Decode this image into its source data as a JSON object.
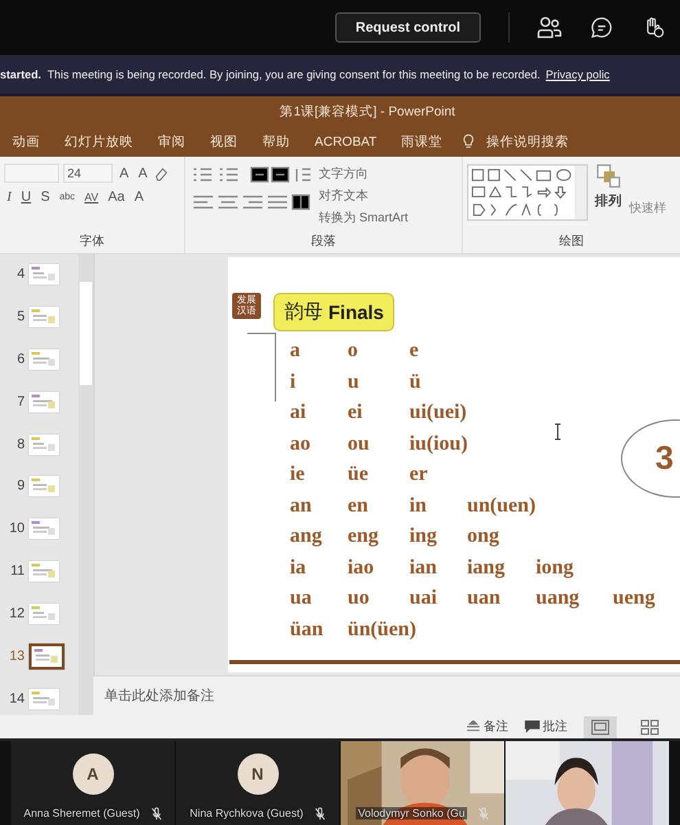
{
  "top_bar": {
    "button": "Request control"
  },
  "banner": {
    "lead": "started.",
    "message": "This meeting is being recorded. By joining, you are giving consent for this meeting to be recorded.",
    "link": "Privacy polic"
  },
  "powerpoint": {
    "title": "第1课[兼容模式] - PowerPoint",
    "tabs": [
      "动画",
      "幻灯片放映",
      "审阅",
      "视图",
      "帮助",
      "ACROBAT",
      "雨课堂"
    ],
    "search": "操作说明搜索",
    "ribbon": {
      "font_size": "24",
      "grow": "A",
      "shrink": "A",
      "font_buttons": [
        "I",
        "U",
        "S",
        "abc",
        "AV",
        "Aa",
        "A"
      ],
      "font_group": "字体",
      "paragraph_commands": [
        "文字方向",
        "对齐文本",
        "转换为 SmartArt"
      ],
      "paragraph_group": "段落",
      "arrange": "排列",
      "quick_styles": "快速样",
      "drawing_group": "绘图"
    },
    "thumbnails": [
      {
        "number": "4",
        "selected": false
      },
      {
        "number": "5",
        "selected": false
      },
      {
        "number": "6",
        "selected": false
      },
      {
        "number": "7",
        "selected": false
      },
      {
        "number": "8",
        "selected": false
      },
      {
        "number": "9",
        "selected": false
      },
      {
        "number": "10",
        "selected": false
      },
      {
        "number": "11",
        "selected": false
      },
      {
        "number": "12",
        "selected": false
      },
      {
        "number": "13",
        "selected": true
      },
      {
        "number": "14",
        "selected": false
      }
    ],
    "slide": {
      "badge": [
        "发展",
        "汉语"
      ],
      "title_cn": "韵母",
      "title_en": "Finals",
      "finals": [
        [
          "a",
          "o",
          "e"
        ],
        [
          "i",
          "u",
          "ü"
        ],
        [
          "ai",
          "ei",
          "ui(uei)"
        ],
        [
          "ao",
          "ou",
          "iu(iou)"
        ],
        [
          "ie",
          "üe",
          "er"
        ],
        [
          "an",
          "en",
          "in",
          "un(uen)"
        ],
        [
          "ang",
          "eng",
          "ing",
          "ong"
        ],
        [
          "ia",
          "iao",
          "ian",
          "iang",
          "iong"
        ],
        [
          "ua",
          "uo",
          "uai",
          "uan",
          "uang",
          "ueng"
        ],
        [
          "üan",
          "ün(üen)"
        ]
      ],
      "circle_text": "3"
    },
    "notes_placeholder": "单击此处添加备注",
    "status_bar": {
      "notes": "备注",
      "comments": "批注"
    }
  },
  "participants": [
    {
      "kind": "avatar",
      "initial": "A",
      "name": "Anna Sheremet (Guest)",
      "muted": true
    },
    {
      "kind": "avatar",
      "initial": "N",
      "name": "Nina Rychkova (Guest)",
      "muted": true
    },
    {
      "kind": "video",
      "name": "Volodymyr Sonko (Gu",
      "muted": true
    },
    {
      "kind": "video"
    }
  ]
}
